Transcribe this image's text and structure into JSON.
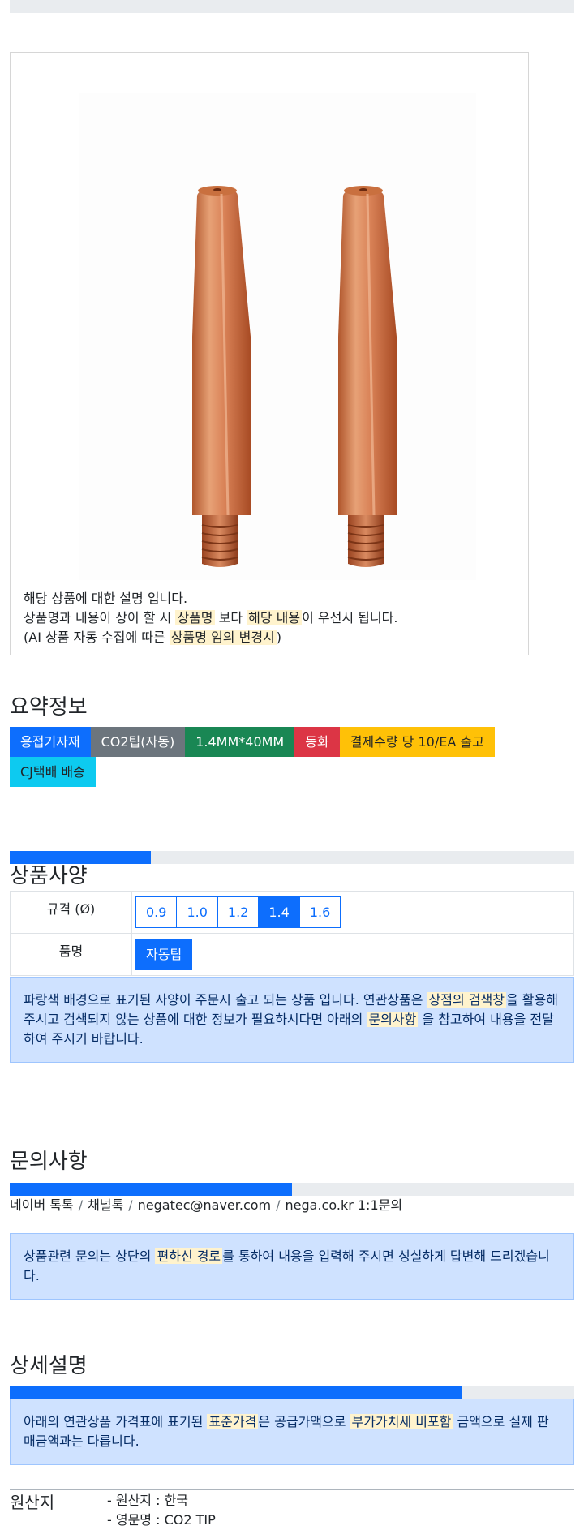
{
  "caption": {
    "line1": "해당 상품에 대한 설명 입니다.",
    "line2_a": "상품명과 내용이 상이 할 시 ",
    "line2_hl1": "상품명",
    "line2_b": " 보다 ",
    "line2_hl2": "해당 내용",
    "line2_c": "이 우선시 됩니다.",
    "line3_a": "(AI 상품 자동 수집에 따른 ",
    "line3_hl": "상품명 임의 변경시",
    "line3_b": ")"
  },
  "summary": {
    "title": "요약정보",
    "badges": [
      {
        "label": "용접기자재",
        "color": "#0d6efd"
      },
      {
        "label": "CO2팁(자동)",
        "color": "#6c757d"
      },
      {
        "label": "1.4MM*40MM",
        "color": "#198754"
      },
      {
        "label": "동화",
        "color": "#dc3545"
      },
      {
        "label": "결제수량 당 10/EA 출고",
        "color": "#ffc107"
      },
      {
        "label": "CJ택배 배송",
        "color": "#0dcaf0"
      }
    ]
  },
  "spec": {
    "progress_pct": 25,
    "title": "상품사양",
    "size_label": "규격 (Ø)",
    "sizes": [
      "0.9",
      "1.0",
      "1.2",
      "1.4",
      "1.6"
    ],
    "selected_size": "1.4",
    "name_label": "품명",
    "name_value": "자동팁",
    "notice_a": "파랑색 배경으로 표기된 사양이 주문시 출고 되는 상품 입니다. 연관상품은 ",
    "notice_hl1": "상점의 검색창",
    "notice_b": "을 활용해 주시고 검색되지 않는 상품에 대한 정보가 필요하시다면 아래의 ",
    "notice_hl2": "문의사항",
    "notice_c": " 을 참고하여 내용을 전달하여 주시기 바랍니다."
  },
  "inquiry": {
    "title": "문의사항",
    "progress_pct": 50,
    "channels": [
      "네이버 톡톡",
      "채널톡",
      "negatec@naver.com",
      "nega.co.kr 1:1문의"
    ],
    "separator": "/",
    "notice_a": "상품관련 문의는 상단의 ",
    "notice_hl": "편하신 경로",
    "notice_b": "를 통하여 내용을 입력해 주시면 성실하게 답변해 드리겠습니다."
  },
  "detail": {
    "title": "상세설명",
    "progress_pct": 80,
    "notice_a": "아래의 연관상품 가격표에 표기된 ",
    "notice_hl1": "표준가격",
    "notice_b": "은 공급가액으로 ",
    "notice_hl2": "부가가치세 비포함",
    "notice_c": " 금액으로 실제 판매금액과는 다릅니다."
  },
  "origin": {
    "label": "원산지",
    "country": "- 원산지 : 한국",
    "english_name": "- 영문명 : CO2 TIP"
  }
}
